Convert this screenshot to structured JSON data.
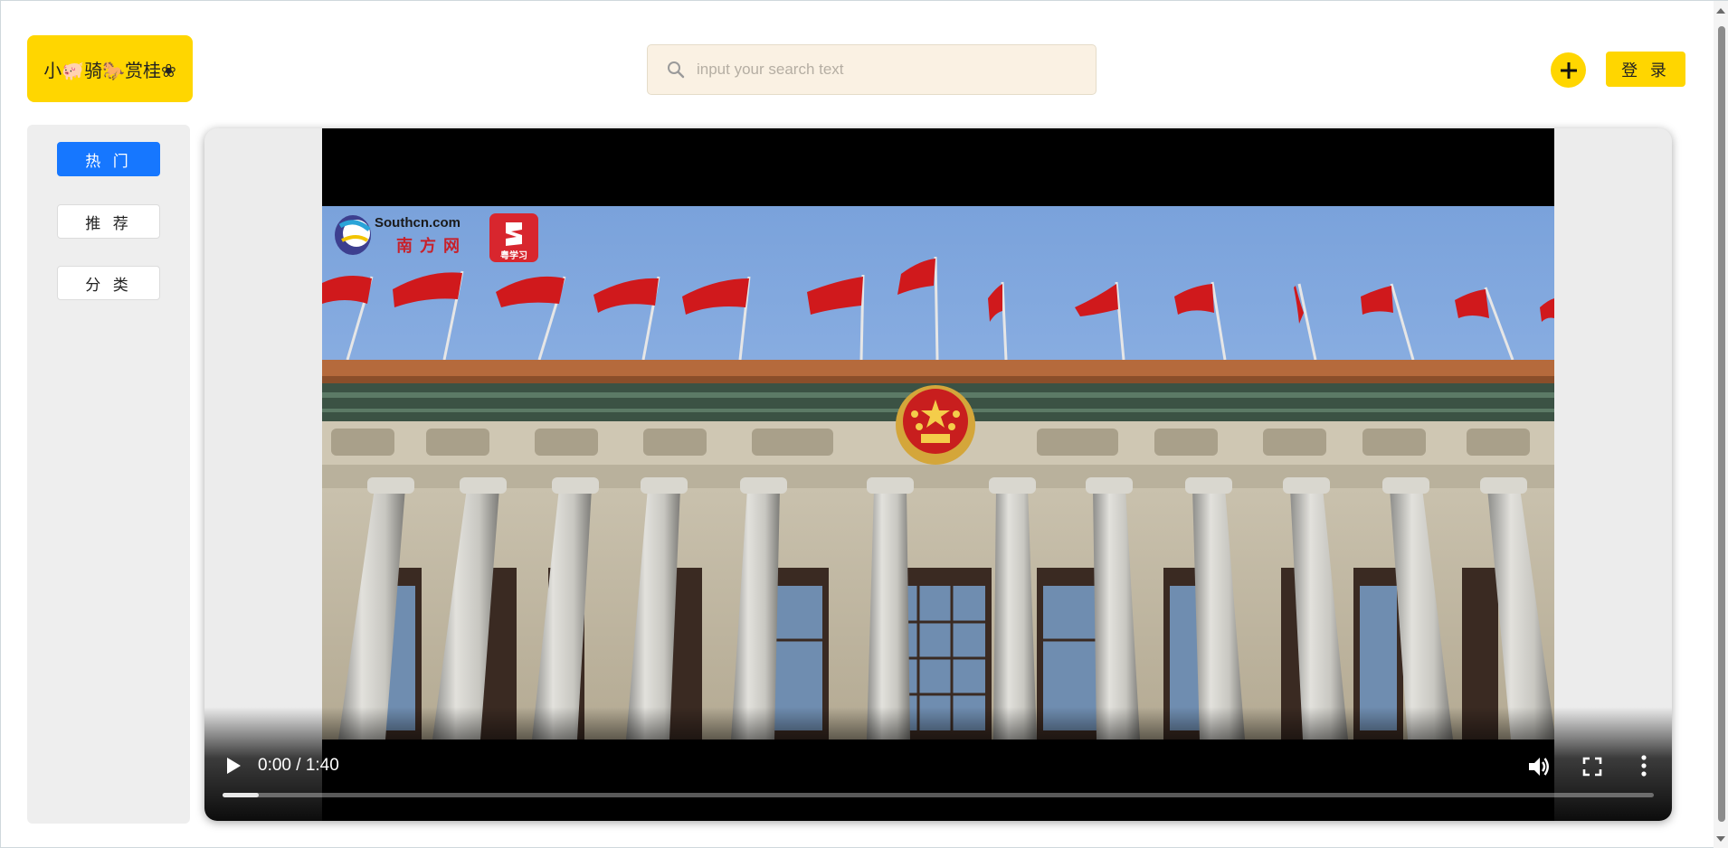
{
  "header": {
    "logo_text": "小🐖骑🐎赏桂❀",
    "search_placeholder": "input your search text",
    "login_label": "登 录",
    "add_icon": "plus-icon",
    "search_icon": "search-icon"
  },
  "sidebar": {
    "items": [
      {
        "label": "热 门",
        "active": true
      },
      {
        "label": "推 荐",
        "active": false
      },
      {
        "label": "分 类",
        "active": false
      }
    ]
  },
  "video": {
    "current_time": "0:00",
    "duration": "1:40",
    "time_display": "0:00 / 1:40",
    "progress_fraction": 0.025,
    "watermark_site": "Southcn.com",
    "watermark_name": "南方网",
    "watermark_app": "粤学习",
    "controls_icons": [
      "play-icon",
      "volume-icon",
      "fullscreen-icon",
      "more-vert-icon"
    ]
  },
  "colors": {
    "accent_yellow": "#ffd600",
    "active_blue": "#1677ff",
    "search_bg": "#faf1e3",
    "sidebar_bg": "#eeeeee",
    "flag_red": "#d21a1a",
    "sky": "#8fb4e3"
  }
}
